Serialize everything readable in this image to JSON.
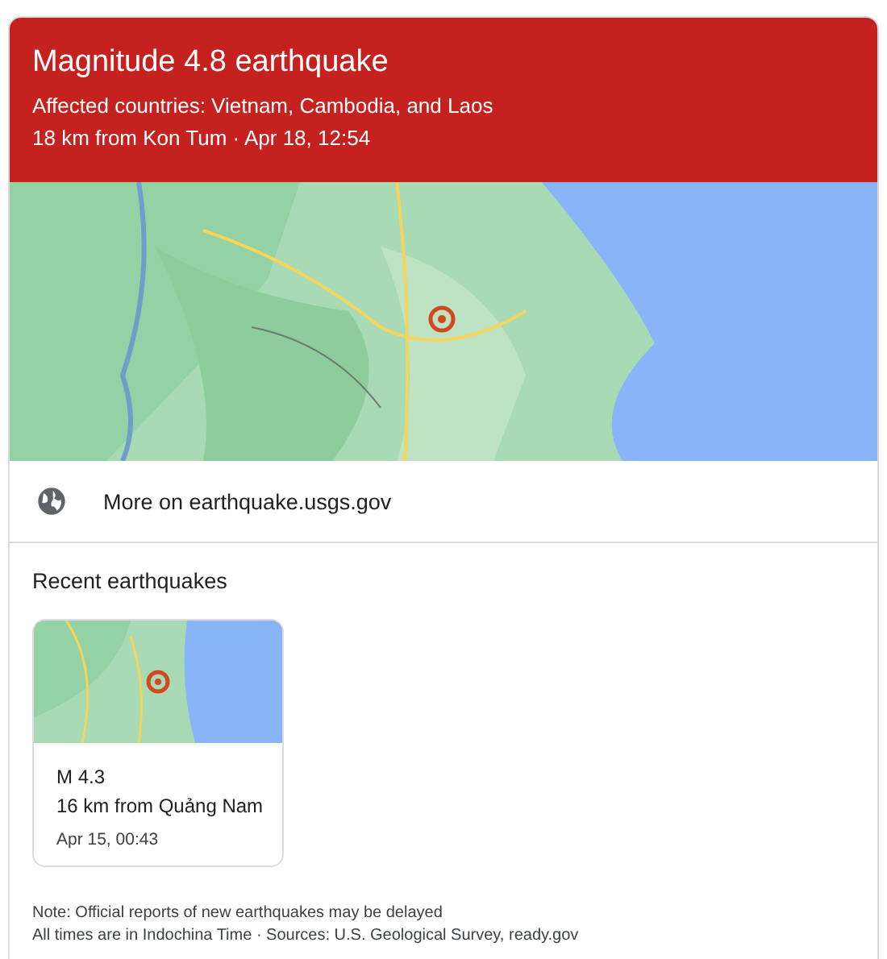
{
  "header": {
    "title": "Magnitude 4.8 earthquake",
    "affected": "Affected countries: Vietnam, Cambodia, and Laos",
    "detail": "18 km from Kon Tum · Apr 18, 12:54"
  },
  "link": {
    "label": "More on earthquake.usgs.gov"
  },
  "recent": {
    "heading": "Recent earthquakes",
    "items": [
      {
        "magnitude": "M 4.3",
        "location": "16 km from Quảng Nam",
        "time": "Apr 15, 00:43"
      }
    ]
  },
  "footer": [
    "Note: Official reports of new earthquakes may be delayed",
    "All times are in Indochina Time · Sources: U.S. Geological Survey, ready.gov"
  ]
}
